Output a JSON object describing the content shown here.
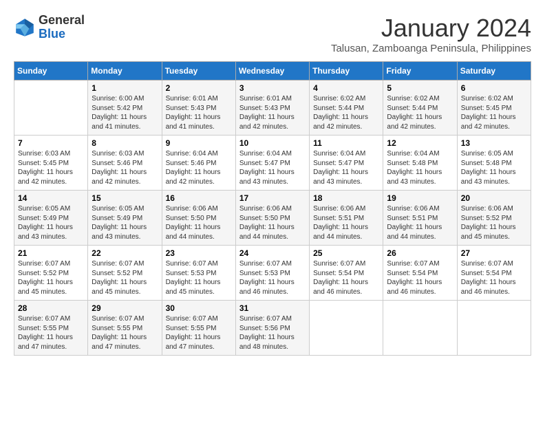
{
  "header": {
    "logo": {
      "general": "General",
      "blue": "Blue"
    },
    "title": "January 2024",
    "location": "Talusan, Zamboanga Peninsula, Philippines"
  },
  "weekdays": [
    "Sunday",
    "Monday",
    "Tuesday",
    "Wednesday",
    "Thursday",
    "Friday",
    "Saturday"
  ],
  "weeks": [
    [
      {
        "day": "",
        "info": ""
      },
      {
        "day": "1",
        "info": "Sunrise: 6:00 AM\nSunset: 5:42 PM\nDaylight: 11 hours\nand 41 minutes."
      },
      {
        "day": "2",
        "info": "Sunrise: 6:01 AM\nSunset: 5:43 PM\nDaylight: 11 hours\nand 41 minutes."
      },
      {
        "day": "3",
        "info": "Sunrise: 6:01 AM\nSunset: 5:43 PM\nDaylight: 11 hours\nand 42 minutes."
      },
      {
        "day": "4",
        "info": "Sunrise: 6:02 AM\nSunset: 5:44 PM\nDaylight: 11 hours\nand 42 minutes."
      },
      {
        "day": "5",
        "info": "Sunrise: 6:02 AM\nSunset: 5:44 PM\nDaylight: 11 hours\nand 42 minutes."
      },
      {
        "day": "6",
        "info": "Sunrise: 6:02 AM\nSunset: 5:45 PM\nDaylight: 11 hours\nand 42 minutes."
      }
    ],
    [
      {
        "day": "7",
        "info": "Sunrise: 6:03 AM\nSunset: 5:45 PM\nDaylight: 11 hours\nand 42 minutes."
      },
      {
        "day": "8",
        "info": "Sunrise: 6:03 AM\nSunset: 5:46 PM\nDaylight: 11 hours\nand 42 minutes."
      },
      {
        "day": "9",
        "info": "Sunrise: 6:04 AM\nSunset: 5:46 PM\nDaylight: 11 hours\nand 42 minutes."
      },
      {
        "day": "10",
        "info": "Sunrise: 6:04 AM\nSunset: 5:47 PM\nDaylight: 11 hours\nand 43 minutes."
      },
      {
        "day": "11",
        "info": "Sunrise: 6:04 AM\nSunset: 5:47 PM\nDaylight: 11 hours\nand 43 minutes."
      },
      {
        "day": "12",
        "info": "Sunrise: 6:04 AM\nSunset: 5:48 PM\nDaylight: 11 hours\nand 43 minutes."
      },
      {
        "day": "13",
        "info": "Sunrise: 6:05 AM\nSunset: 5:48 PM\nDaylight: 11 hours\nand 43 minutes."
      }
    ],
    [
      {
        "day": "14",
        "info": "Sunrise: 6:05 AM\nSunset: 5:49 PM\nDaylight: 11 hours\nand 43 minutes."
      },
      {
        "day": "15",
        "info": "Sunrise: 6:05 AM\nSunset: 5:49 PM\nDaylight: 11 hours\nand 43 minutes."
      },
      {
        "day": "16",
        "info": "Sunrise: 6:06 AM\nSunset: 5:50 PM\nDaylight: 11 hours\nand 44 minutes."
      },
      {
        "day": "17",
        "info": "Sunrise: 6:06 AM\nSunset: 5:50 PM\nDaylight: 11 hours\nand 44 minutes."
      },
      {
        "day": "18",
        "info": "Sunrise: 6:06 AM\nSunset: 5:51 PM\nDaylight: 11 hours\nand 44 minutes."
      },
      {
        "day": "19",
        "info": "Sunrise: 6:06 AM\nSunset: 5:51 PM\nDaylight: 11 hours\nand 44 minutes."
      },
      {
        "day": "20",
        "info": "Sunrise: 6:06 AM\nSunset: 5:52 PM\nDaylight: 11 hours\nand 45 minutes."
      }
    ],
    [
      {
        "day": "21",
        "info": "Sunrise: 6:07 AM\nSunset: 5:52 PM\nDaylight: 11 hours\nand 45 minutes."
      },
      {
        "day": "22",
        "info": "Sunrise: 6:07 AM\nSunset: 5:52 PM\nDaylight: 11 hours\nand 45 minutes."
      },
      {
        "day": "23",
        "info": "Sunrise: 6:07 AM\nSunset: 5:53 PM\nDaylight: 11 hours\nand 45 minutes."
      },
      {
        "day": "24",
        "info": "Sunrise: 6:07 AM\nSunset: 5:53 PM\nDaylight: 11 hours\nand 46 minutes."
      },
      {
        "day": "25",
        "info": "Sunrise: 6:07 AM\nSunset: 5:54 PM\nDaylight: 11 hours\nand 46 minutes."
      },
      {
        "day": "26",
        "info": "Sunrise: 6:07 AM\nSunset: 5:54 PM\nDaylight: 11 hours\nand 46 minutes."
      },
      {
        "day": "27",
        "info": "Sunrise: 6:07 AM\nSunset: 5:54 PM\nDaylight: 11 hours\nand 46 minutes."
      }
    ],
    [
      {
        "day": "28",
        "info": "Sunrise: 6:07 AM\nSunset: 5:55 PM\nDaylight: 11 hours\nand 47 minutes."
      },
      {
        "day": "29",
        "info": "Sunrise: 6:07 AM\nSunset: 5:55 PM\nDaylight: 11 hours\nand 47 minutes."
      },
      {
        "day": "30",
        "info": "Sunrise: 6:07 AM\nSunset: 5:55 PM\nDaylight: 11 hours\nand 47 minutes."
      },
      {
        "day": "31",
        "info": "Sunrise: 6:07 AM\nSunset: 5:56 PM\nDaylight: 11 hours\nand 48 minutes."
      },
      {
        "day": "",
        "info": ""
      },
      {
        "day": "",
        "info": ""
      },
      {
        "day": "",
        "info": ""
      }
    ]
  ]
}
